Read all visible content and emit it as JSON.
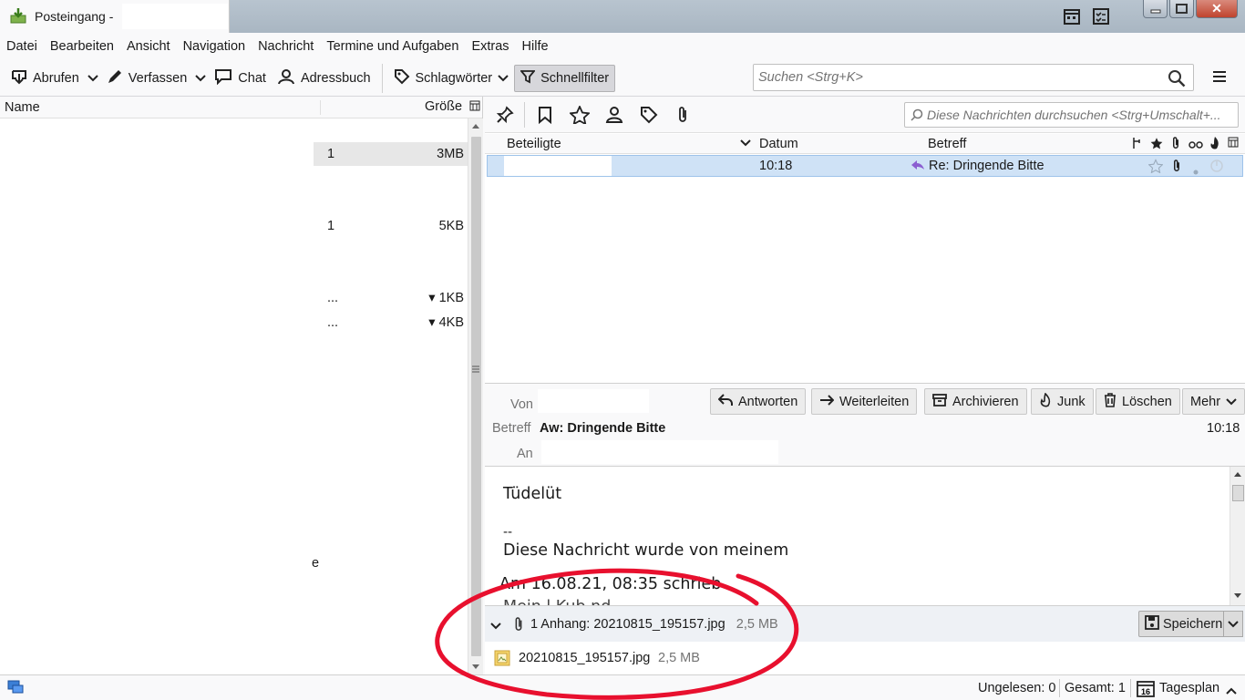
{
  "window": {
    "tab_title": "Posteingang -",
    "accent": "#0a84ff"
  },
  "menu": {
    "items": [
      "Datei",
      "Bearbeiten",
      "Ansicht",
      "Navigation",
      "Nachricht",
      "Termine und Aufgaben",
      "Extras",
      "Hilfe"
    ]
  },
  "toolbar": {
    "get_mail": "Abrufen",
    "write": "Verfassen",
    "chat": "Chat",
    "address_book": "Adressbuch",
    "tags": "Schlagwörter",
    "quick_filter": "Schnellfilter",
    "search_placeholder": "Suchen <Strg+K>"
  },
  "folder_pane": {
    "col_name": "Name",
    "col_size": "Größe",
    "rows": [
      {
        "count": "1",
        "size": "3MB",
        "selected": true
      },
      {
        "count": "1",
        "size": "5KB"
      },
      {
        "count": "...",
        "size": "▾ 1KB"
      },
      {
        "count": "...",
        "size": "▾ 4KB"
      }
    ],
    "fragment": "e"
  },
  "quick_filter": {
    "search_placeholder": "Diese Nachrichten durchsuchen <Strg+Umschalt+..."
  },
  "thread": {
    "col_participants": "Beteiligte",
    "col_date": "Datum",
    "col_subject": "Betreff",
    "rows": [
      {
        "date": "10:18",
        "subject": "Re:  Dringende Bitte",
        "selected": true
      }
    ]
  },
  "message": {
    "label_from": "Von",
    "label_subject": "Betreff",
    "label_to": "An",
    "subject": "Aw: Dringende Bitte",
    "time": "10:18",
    "buttons": {
      "reply": "Antworten",
      "forward": "Weiterleiten",
      "archive": "Archivieren",
      "junk": "Junk",
      "delete": "Löschen",
      "more": "Mehr"
    },
    "body": {
      "line1": "Tüdelüt",
      "sig_sep": "--",
      "line2": "Diese Nachricht wurde von meinem",
      "line3": "Am 16.08.21, 08:35 schrieb",
      "line4": "Mein l     Kub  nd"
    },
    "attachment": {
      "summary": "1 Anhang: 20210815_195157.jpg",
      "summary_size": "2,5 MB",
      "save": "Speichern",
      "file_name": "20210815_195157.jpg",
      "file_size": "2,5 MB"
    }
  },
  "status": {
    "unread": "Ungelesen: 0",
    "total": "Gesamt: 1",
    "today_pane": "Tagesplan",
    "calendar_day": "16"
  },
  "annotation_color": "#e8102e"
}
